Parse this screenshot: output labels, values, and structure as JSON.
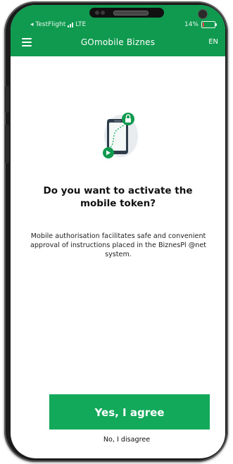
{
  "status_bar": {
    "back_app": "◂ TestFlight",
    "network": "LTE",
    "battery_percent": "14%",
    "battery_level": 0.14
  },
  "app_bar": {
    "title": "GOmobile Biznes",
    "language": "EN",
    "menu_icon": "hamburger-menu-icon"
  },
  "illustration": {
    "icon": "phone-with-lock-icon",
    "accent_color": "#109a4f"
  },
  "content": {
    "headline": "Do you want to activate the mobile token?",
    "description": "Mobile authorisation facilitates safe and convenient approval of instructions placed in the BiznesPl @net system."
  },
  "actions": {
    "agree_label": "Yes, I agree",
    "disagree_label": "No, I disagree"
  },
  "colors": {
    "brand_green": "#109a4f",
    "button_green": "#13a95b"
  }
}
